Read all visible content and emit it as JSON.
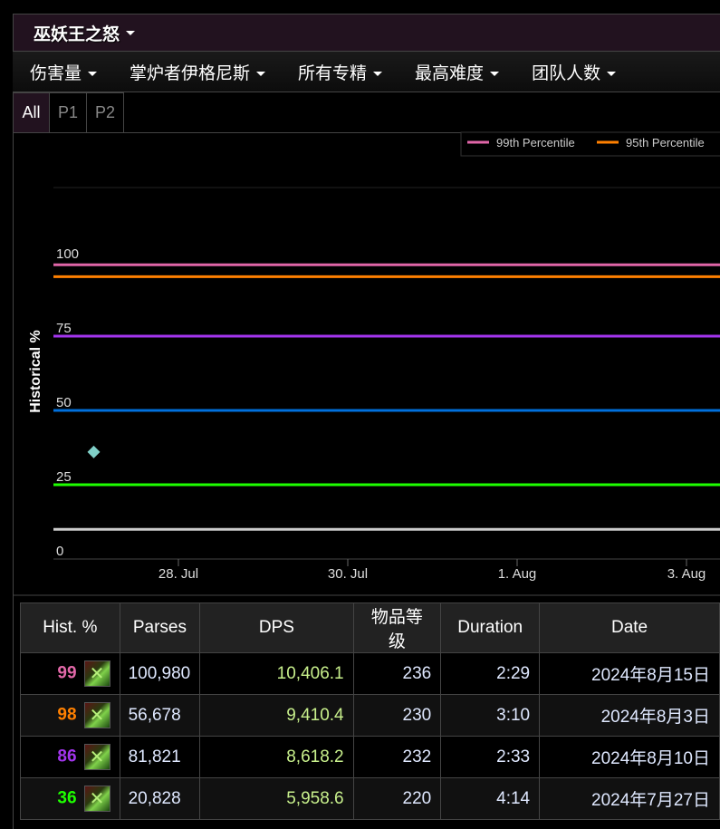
{
  "title": "巫妖王之怒",
  "filters": [
    "伤害量",
    "掌炉者伊格尼斯",
    "所有专精",
    "最高难度",
    "团队人数"
  ],
  "tabs": [
    "All",
    "P1",
    "P2"
  ],
  "active_tab": "All",
  "chart_data": {
    "type": "line",
    "ylabel": "Historical %",
    "yticks": [
      "0",
      "25",
      "50",
      "75",
      "100"
    ],
    "ylim": [
      0,
      125
    ],
    "xticks": [
      "28. Jul",
      "30. Jul",
      "1. Aug",
      "3. Aug"
    ],
    "xtick_dates": [
      "2024-07-28",
      "2024-07-30",
      "2024-08-01",
      "2024-08-03"
    ],
    "legend": {
      "placement": "top-right",
      "entries": [
        {
          "name": "99th Percentile",
          "color": "#e066a8"
        },
        {
          "name": "95th Percentile",
          "color": "#ff8000"
        }
      ]
    },
    "series": [
      {
        "name": "99th Percentile",
        "color": "#e066a8",
        "value": 99
      },
      {
        "name": "95th Percentile",
        "color": "#ff8000",
        "value": 95
      },
      {
        "color": "#a335ee",
        "value": 75
      },
      {
        "color": "#0070dd",
        "value": 50
      },
      {
        "color": "#1eff00",
        "value": 25
      },
      {
        "color": "#cccccc",
        "value": 10
      }
    ],
    "points": [
      {
        "date": "2024-07-27",
        "value": 36,
        "color": "#80d0c8"
      }
    ]
  },
  "table": {
    "headers": [
      "Hist. %",
      "Parses",
      "DPS",
      "物品等级",
      "Duration",
      "Date"
    ],
    "rows": [
      {
        "pct": "99",
        "color": "#e268a8",
        "parses": "100,980",
        "dps": "10,406.1",
        "ilvl": "236",
        "dur": "2:29",
        "date": "2024年8月15日"
      },
      {
        "pct": "98",
        "color": "#ff8000",
        "parses": "56,678",
        "dps": "9,410.4",
        "ilvl": "230",
        "dur": "3:10",
        "date": "2024年8月3日"
      },
      {
        "pct": "86",
        "color": "#a335ee",
        "parses": "81,821",
        "dps": "8,618.2",
        "ilvl": "232",
        "dur": "2:33",
        "date": "2024年8月10日"
      },
      {
        "pct": "36",
        "color": "#1eff00",
        "parses": "20,828",
        "dps": "5,958.6",
        "ilvl": "220",
        "dur": "4:14",
        "date": "2024年7月27日"
      }
    ]
  }
}
